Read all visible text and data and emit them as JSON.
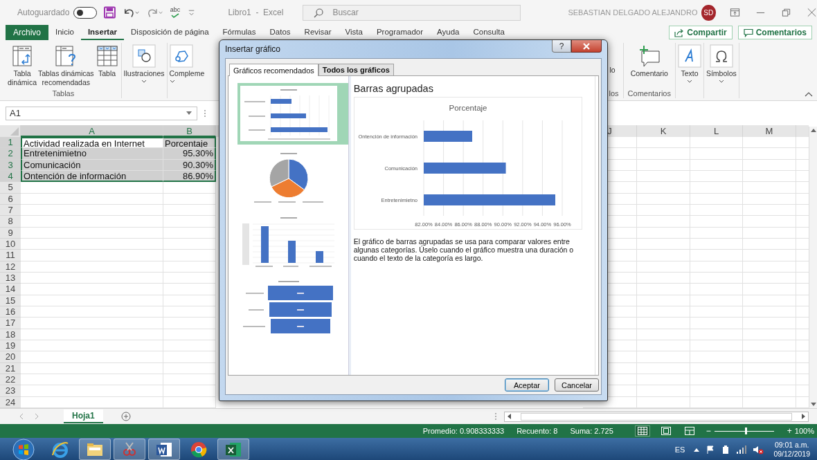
{
  "title_bar": {
    "autosave_label": "Autoguardado",
    "autosave_on": false,
    "spelling_label": "abc",
    "document_title": "Libro1  -  Excel",
    "search": {
      "placeholder": "Buscar"
    },
    "user_name": "SEBASTIAN DELGADO ALEJANDRO",
    "user_initials": "SD"
  },
  "file_button": "Archivo",
  "menu_tabs": [
    {
      "label": "Inicio",
      "selected": false
    },
    {
      "label": "Insertar",
      "selected": true
    },
    {
      "label": "Disposición de página",
      "selected": false
    },
    {
      "label": "Fórmulas",
      "selected": false
    },
    {
      "label": "Datos",
      "selected": false
    },
    {
      "label": "Revisar",
      "selected": false
    },
    {
      "label": "Vista",
      "selected": false
    },
    {
      "label": "Programador",
      "selected": false
    },
    {
      "label": "Ayuda",
      "selected": false
    },
    {
      "label": "Consulta",
      "selected": false
    }
  ],
  "share_button": "Compartir",
  "comments_button": "Comentarios",
  "ribbon": {
    "groups": [
      {
        "label": "Tablas",
        "commands": [
          {
            "label": "Tabla\ndinámica",
            "kind": "pivot",
            "dropdown": false
          },
          {
            "label": "Tablas dinámicas\nrecomendadas",
            "kind": "recommended",
            "dropdown": false
          },
          {
            "label": "Tabla",
            "kind": "table",
            "dropdown": false
          }
        ]
      },
      {
        "commands": [
          {
            "label": "Ilustraciones",
            "kind": "shapes",
            "dropdown": true
          }
        ]
      },
      {
        "commands": [
          {
            "label": "Compleme",
            "kind": "addin",
            "dropdown": true
          }
        ]
      },
      {
        "label": "los",
        "commands": [
          {
            "label": "lo",
            "kind": "covered",
            "dropdown": false
          }
        ]
      },
      {
        "label": "Comentarios",
        "commands": [
          {
            "label": "Comentario",
            "kind": "comment",
            "dropdown": false
          }
        ]
      },
      {
        "commands": [
          {
            "label": "Texto",
            "kind": "text",
            "dropdown": true
          }
        ]
      },
      {
        "commands": [
          {
            "label": "Símbolos",
            "kind": "omega",
            "dropdown": true
          }
        ]
      }
    ]
  },
  "formula_bar": {
    "name_box": "A1"
  },
  "sheet": {
    "columns": [
      {
        "label": "A",
        "selected": true
      },
      {
        "label": "B",
        "selected": true
      },
      {
        "label": "J",
        "selected": false
      },
      {
        "label": "K",
        "selected": false
      },
      {
        "label": "L",
        "selected": false
      },
      {
        "label": "M",
        "selected": false
      }
    ],
    "rows": [
      {
        "label": "1",
        "selected": true,
        "cells": [
          {
            "text": "Actividad realizada en Internet",
            "kind": "text",
            "active": true
          },
          {
            "text": "Porcentaje",
            "kind": "text",
            "active": false
          }
        ]
      },
      {
        "label": "2",
        "selected": true,
        "cells": [
          {
            "text": "Entretenimietno",
            "kind": "text",
            "active": false
          },
          {
            "text": "95.30%",
            "kind": "number",
            "active": false
          }
        ]
      },
      {
        "label": "3",
        "selected": true,
        "cells": [
          {
            "text": "Comunicación",
            "kind": "text",
            "active": false
          },
          {
            "text": "90.30%",
            "kind": "number",
            "active": false
          }
        ]
      },
      {
        "label": "4",
        "selected": true,
        "cells": [
          {
            "text": "Ontención de información",
            "kind": "text",
            "active": false
          },
          {
            "text": "86.90%",
            "kind": "number",
            "active": false
          }
        ]
      },
      {
        "label": "5",
        "selected": false
      },
      {
        "label": "6",
        "selected": false
      },
      {
        "label": "7",
        "selected": false
      },
      {
        "label": "8",
        "selected": false
      },
      {
        "label": "9",
        "selected": false
      },
      {
        "label": "10",
        "selected": false
      },
      {
        "label": "11",
        "selected": false
      },
      {
        "label": "12",
        "selected": false
      },
      {
        "label": "13",
        "selected": false
      },
      {
        "label": "14",
        "selected": false
      },
      {
        "label": "15",
        "selected": false
      },
      {
        "label": "16",
        "selected": false
      },
      {
        "label": "17",
        "selected": false
      },
      {
        "label": "18",
        "selected": false
      },
      {
        "label": "19",
        "selected": false
      },
      {
        "label": "20",
        "selected": false
      },
      {
        "label": "21",
        "selected": false
      },
      {
        "label": "22",
        "selected": false
      },
      {
        "label": "23",
        "selected": false
      },
      {
        "label": "24",
        "selected": false
      }
    ]
  },
  "sheet_tabs": [
    {
      "label": "Hoja1",
      "selected": true
    }
  ],
  "status_bar": {
    "average": "Promedio: 0.908333333",
    "count": "Recuento: 8",
    "sum": "Suma: 2.725",
    "views": [
      {
        "kind": "normal",
        "selected": true
      },
      {
        "kind": "page_layout",
        "selected": false
      },
      {
        "kind": "page_break",
        "selected": false
      }
    ],
    "zoom": {
      "minus": "−",
      "plus": "+",
      "level": 0.52,
      "reading": "100%"
    }
  },
  "taskbar": {
    "apps": [
      {
        "kind": "ie",
        "running": false
      },
      {
        "kind": "explorer",
        "running": true
      },
      {
        "kind": "snipping",
        "running": true
      },
      {
        "kind": "word",
        "running": true
      },
      {
        "kind": "chrome",
        "running": false
      },
      {
        "kind": "excel",
        "running": true
      }
    ],
    "language": "ES",
    "time": "09:01 a.m.",
    "date": "09/12/2019"
  },
  "dialog": {
    "title": "Insertar gráfico",
    "help": "?",
    "tabs": [
      {
        "label": "Gráficos recomendados",
        "selected": true
      },
      {
        "label": "Todos los gráficos",
        "selected": false
      }
    ],
    "thumbnails": [
      {
        "kind": "bar",
        "selected": true
      },
      {
        "kind": "pie",
        "selected": false
      },
      {
        "kind": "column",
        "selected": false
      },
      {
        "kind": "funnel",
        "selected": false
      }
    ],
    "preview": {
      "heading": "Barras agrupadas",
      "chart_data": {
        "type": "bar",
        "orientation": "horizontal",
        "grid": true,
        "title": "Porcentaje",
        "categories": [
          "Ontención de información",
          "Comunicación",
          "Entretenimietno"
        ],
        "values": [
          0.869,
          0.903,
          0.953
        ],
        "xlim": [
          0.82,
          0.96
        ],
        "xticks": [
          {
            "value": 0.82,
            "label": "82.00%"
          },
          {
            "value": 0.84,
            "label": "84.00%"
          },
          {
            "value": 0.86,
            "label": "86.00%"
          },
          {
            "value": 0.88,
            "label": "88.00%"
          },
          {
            "value": 0.9,
            "label": "90.00%"
          },
          {
            "value": 0.92,
            "label": "92.00%"
          },
          {
            "value": 0.94,
            "label": "94.00%"
          },
          {
            "value": 0.96,
            "label": "96.00%"
          }
        ]
      },
      "description": "El gráfico de barras agrupadas se usa para comparar valores entre algunas categorías. Úselo cuando el gráfico muestra una duración o cuando el texto de la categoría es largo."
    },
    "buttons": [
      {
        "label": "Aceptar",
        "default": true
      },
      {
        "label": "Cancelar",
        "default": false
      }
    ]
  }
}
